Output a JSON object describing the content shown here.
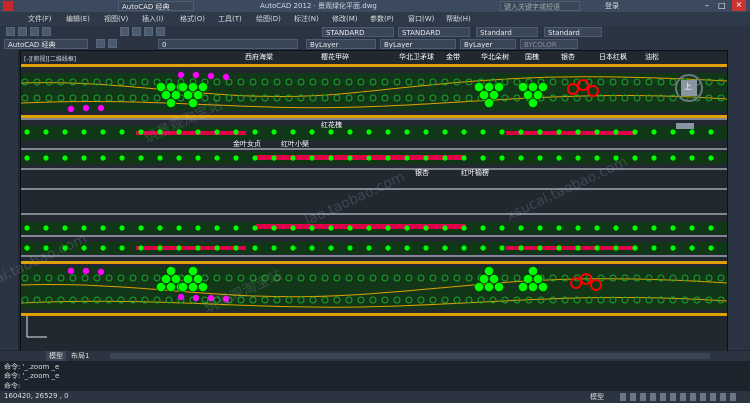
{
  "window": {
    "title": "AutoCAD 2012  · 景观绿化平面.dwg",
    "search_placeholder": "键入关键字或短语",
    "login": "登录"
  },
  "menus": [
    "文件(F)",
    "编辑(E)",
    "视图(V)",
    "插入(I)",
    "格式(O)",
    "工具(T)",
    "绘图(D)",
    "标注(N)",
    "修改(M)",
    "参数(P)",
    "窗口(W)",
    "帮助(H)"
  ],
  "toolbars": {
    "workspace": "AutoCAD 经典",
    "text_style": "STANDARD",
    "dim_style": "STANDARD",
    "table_style": "Standard",
    "mleader_style": "Standard",
    "workspace2": "AutoCAD 经典",
    "layer": "0",
    "color": "ByLayer",
    "linetype": "ByLayer",
    "lineweight": "ByLayer",
    "plotstyle": "BYCOLOR"
  },
  "viewport": {
    "label": "[-][俯视][二维线框]",
    "viewcube": "上"
  },
  "plant_labels": {
    "zizhuhaitang": "西府海棠",
    "yinghuajian": "樱花甲碎",
    "huabeiwuzhi": "华北卫矛球",
    "jindai": "金带",
    "huabeiluoshu": "华北朵树",
    "guohuai": "国槐",
    "yinxing1": "银杏",
    "ribenhongfeng": "日本红枫",
    "youson": "油松",
    "honghuajinji": "红花槐",
    "jinyenuzhen": "金叶女贞",
    "hongyexiaobo": "红叶小檗",
    "yinxing2": "银杏",
    "hongyeyuanliu": "红叶榆楞"
  },
  "tabs": {
    "model": "模型",
    "layout": "布局1"
  },
  "command": {
    "line1": "命令: '_.zoom _e",
    "line2": "命令: '_.zoom _e",
    "prompt": "命令:"
  },
  "status": {
    "coords": "160420, 26529 , 0",
    "model": "模型"
  },
  "watermarks": {
    "w1": "筑景观淘宝站",
    "w2": "lao.taobao.com",
    "w3": "ai.taobao.com",
    "w4": "xsucai.taobao.com"
  },
  "colors": {
    "hedge": "#e0a000",
    "green": "#00ff00",
    "red": "#ff0000",
    "magenta": "#ff00ff",
    "crimson": "#e0004a",
    "white": "#ffffff"
  }
}
